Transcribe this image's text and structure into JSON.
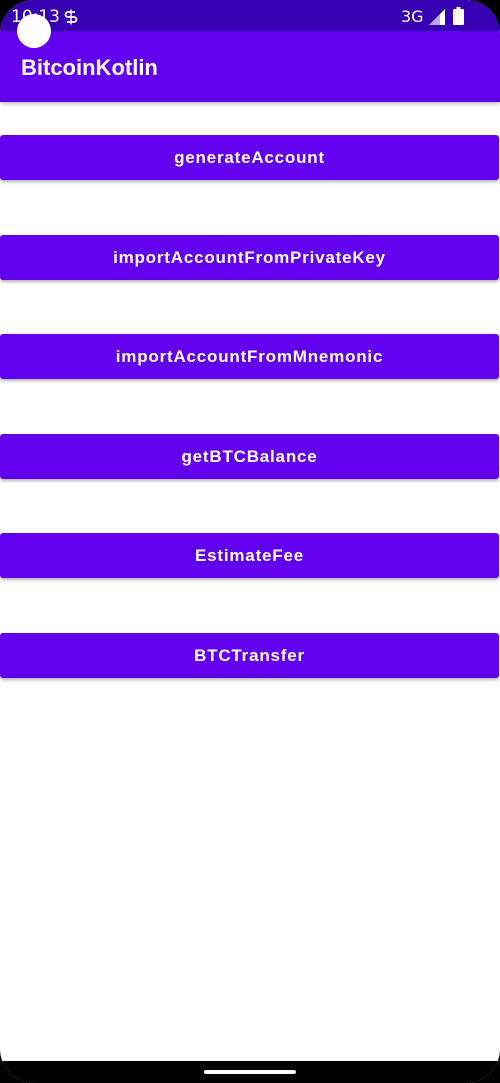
{
  "status_bar": {
    "time": "10:13",
    "network": "3G",
    "icons": [
      "sim-s-icon",
      "signal-icon",
      "battery-icon"
    ]
  },
  "app_bar": {
    "title": "BitcoinKotlin"
  },
  "buttons": [
    {
      "label": "generateAccount"
    },
    {
      "label": "importAccountFromPrivateKey"
    },
    {
      "label": "importAccountFromMnemonic"
    },
    {
      "label": "getBTCBalance"
    },
    {
      "label": "EstimateFee"
    },
    {
      "label": "BTCTransfer"
    }
  ],
  "colors": {
    "status_bar": "#3700B3",
    "primary": "#6200EE",
    "background": "#FFFFFF"
  }
}
